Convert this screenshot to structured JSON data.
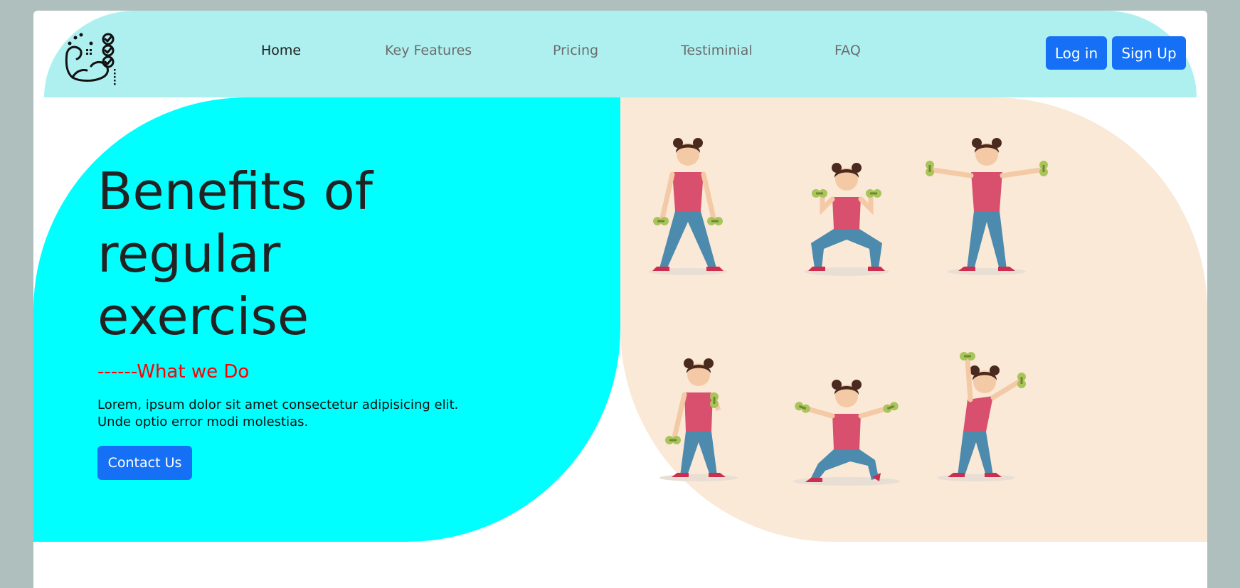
{
  "nav": {
    "logo_icon": "muscle-arm-checklist-icon",
    "links": [
      {
        "label": "Home",
        "active": true
      },
      {
        "label": "Key Features",
        "active": false
      },
      {
        "label": "Pricing",
        "active": false
      },
      {
        "label": "Testiminial",
        "active": false
      },
      {
        "label": "FAQ",
        "active": false
      }
    ],
    "login_label": "Log in",
    "signup_label": "Sign Up"
  },
  "hero": {
    "title": "Benefits of regular exercise",
    "subtitle": "------What we Do",
    "description": "Lorem, ipsum dolor sit amet consectetur adipisicing elit. Unde optio error modi molestias.",
    "cta_label": "Contact Us",
    "illustration": "woman-dumbbell-exercises-illustration"
  },
  "colors": {
    "background": "#aebfbd",
    "navbar": "#aef0f0",
    "hero_left": "#00ffff",
    "hero_right": "#f9e9d6",
    "primary_button": "#1670f5",
    "subtitle": "#ff0000"
  }
}
